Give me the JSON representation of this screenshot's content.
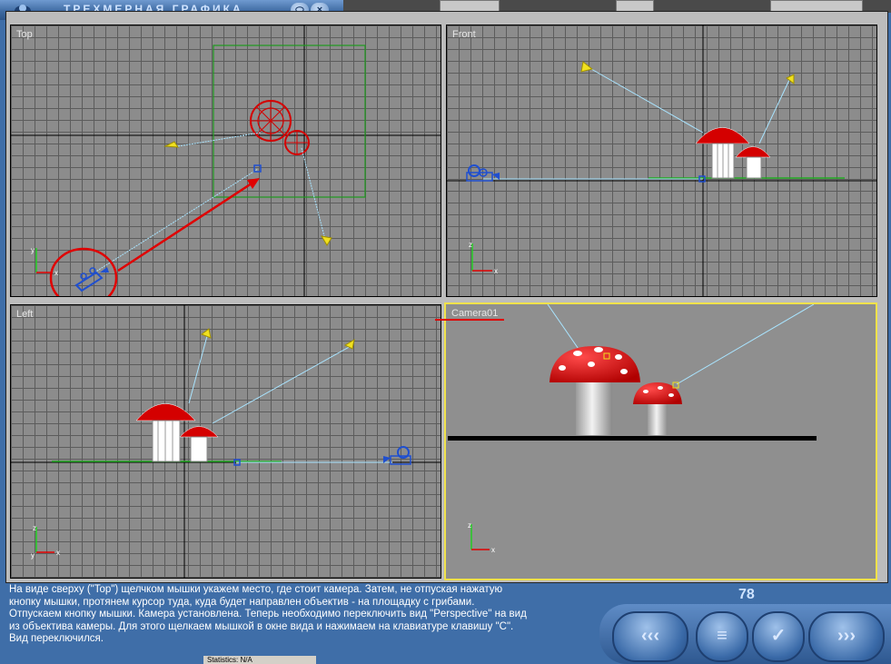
{
  "window": {
    "title": "ТРЕХМЕРНАЯ ГРАФИКА",
    "minimize_glyph": "⬭",
    "close_glyph": "×",
    "icon": "app-logo-icon"
  },
  "viewports": {
    "top": {
      "label": "Top"
    },
    "front": {
      "label": "Front"
    },
    "left": {
      "label": "Left"
    },
    "camera": {
      "label": "Camera01"
    }
  },
  "axis_labels": {
    "x": "x",
    "y": "y",
    "z": "z"
  },
  "instruction": {
    "line1": "На виде сверху (\"Top\") щелчком мышки укажем место, где стоит камера. Затем, не отпуская нажатую",
    "line2": "кнопку мышки, протянем курсор туда, куда будет направлен объектив - на площадку с грибами.",
    "line3": "Отпускаем кнопку мышки. Камера установлена. Теперь необходимо переключить вид \"Perspective\" на вид",
    "line4": "из объектива камеры. Для этого щелкаем мышкой в окне вида и нажимаем на клавиатуре клавишу \"C\".",
    "line5": "Вид переключился."
  },
  "page_number": "78",
  "nav": {
    "prev_glyph": "‹‹‹",
    "menu_glyph": "≡",
    "ok_glyph": "✓",
    "next_glyph": "›››"
  },
  "statusbar": {
    "text": "Statistics: N/A"
  },
  "colors": {
    "panel": "#3f6ea8",
    "viewport_bg": "#8c8c8c",
    "grid": "#5c5c5c",
    "active_border": "#f0e24a",
    "annotation_red": "#e00000",
    "mushroom_red": "#d40000",
    "camera_blue": "#1f4fd0",
    "light_yellow": "#f0e020",
    "ground_green": "#22aa22"
  }
}
